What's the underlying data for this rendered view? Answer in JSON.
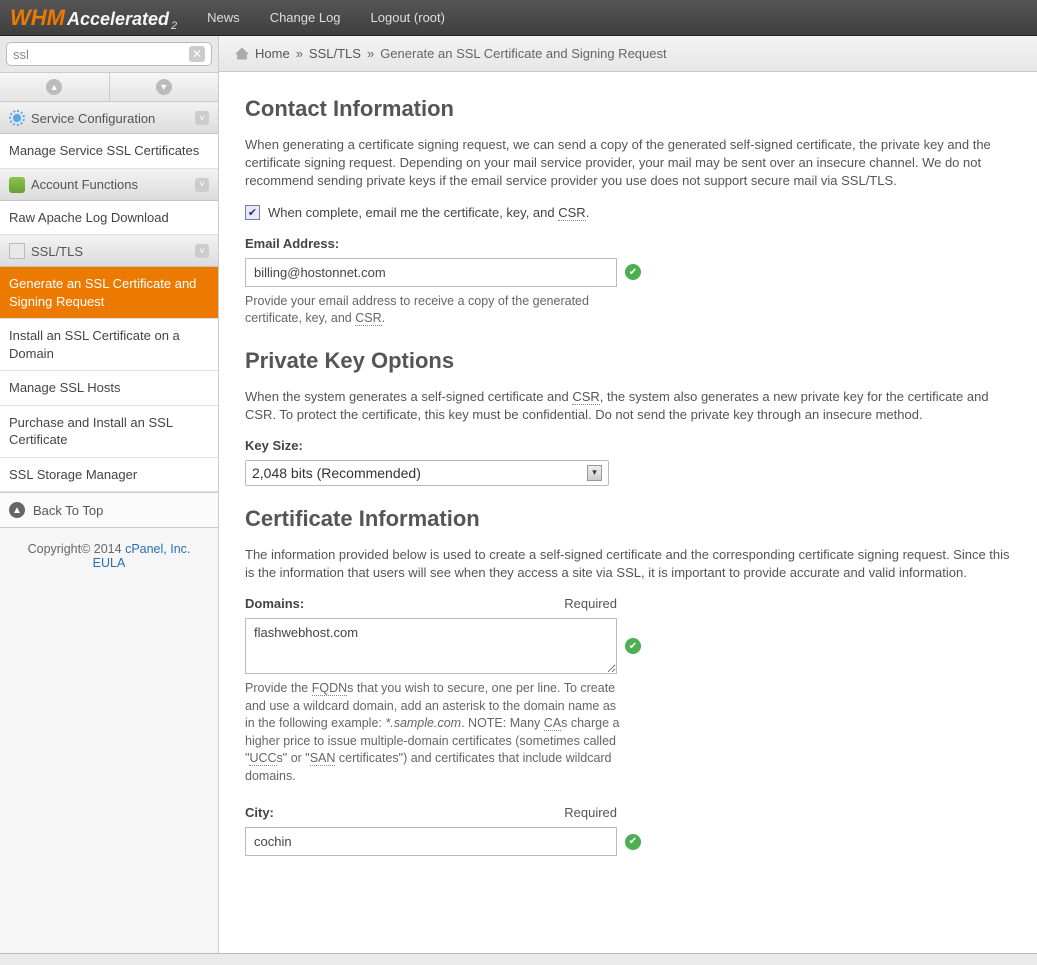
{
  "top": {
    "logo_whm": "WHM",
    "logo_accel": "Accelerated",
    "logo_sub": "2",
    "links": [
      "News",
      "Change Log",
      "Logout (root)"
    ]
  },
  "search": {
    "value": "ssl"
  },
  "side_sections": [
    {
      "label": "Service Configuration"
    },
    {
      "label": "Account Functions"
    },
    {
      "label": "SSL/TLS"
    }
  ],
  "side_items": {
    "manage_service_ssl": "Manage Service SSL Certificates",
    "raw_apache": "Raw Apache Log Download",
    "gen_csr": "Generate an SSL Certificate and Signing Request",
    "install_ssl": "Install an SSL Certificate on a Domain",
    "manage_hosts": "Manage SSL Hosts",
    "purchase_install": "Purchase and Install an SSL Certificate",
    "storage_mgr": "SSL Storage Manager",
    "back_top": "Back To Top"
  },
  "footer": {
    "copyright": "Copyright© 2014 ",
    "cpanel_link": "cPanel, Inc.",
    "eula_link": "EULA"
  },
  "breadcrumb": {
    "home": "Home",
    "ssl": "SSL/TLS",
    "current": "Generate an SSL Certificate and Signing Request",
    "sep": "»"
  },
  "sections": {
    "contact_h": "Contact Information",
    "contact_p": "When generating a certificate signing request, we can send a copy of the generated self-signed certificate, the private key and the certificate signing request. Depending on your mail service provider, your mail may be sent over an insecure channel. We do not recommend sending private keys if the email service provider you use does not support secure mail via SSL/TLS.",
    "checkbox_label_pre": "When complete, email me the certificate, key, and ",
    "csr_abbr": "CSR",
    "email_label": "Email Address:",
    "email_value": "billing@hostonnet.com",
    "email_hint_pre": "Provide your email address to receive a copy of the generated certificate, key, and ",
    "pk_h": "Private Key Options",
    "pk_p_pre": "When the system generates a self-signed certificate and ",
    "pk_p_post": ", the system also generates a new private key for the certificate and CSR. To protect the certificate, this key must be confidential. Do not send the private key through an insecure method.",
    "keysize_label": "Key Size:",
    "keysize_value": "2,048 bits (Recommended)",
    "cert_h": "Certificate Information",
    "cert_p": "The information provided below is used to create a self-signed certificate and the corresponding certificate signing request. Since this is the information that users will see when they access a site via SSL, it is important to provide accurate and valid information.",
    "domains_label": "Domains:",
    "required": "Required",
    "domains_value": "flashwebhost.com",
    "domains_hint_1": "Provide the ",
    "fqdn_abbr": "FQDN",
    "domains_hint_2": "s that you wish to secure, one per line. To create and use a wildcard domain, add an asterisk to the domain name as in the following example: ",
    "sample_domain": "*.sample.com",
    "domains_hint_3": ". NOTE: Many ",
    "ca_abbr": "CA",
    "domains_hint_4": "s charge a higher price to issue multiple-domain certificates (sometimes called \"",
    "ucc_abbr": "UCC",
    "domains_hint_5": "s\" or \"",
    "san_abbr": "SAN",
    "domains_hint_6": " certificates\") and certificates that include wildcard domains.",
    "city_label": "City:",
    "city_value": "cochin"
  }
}
